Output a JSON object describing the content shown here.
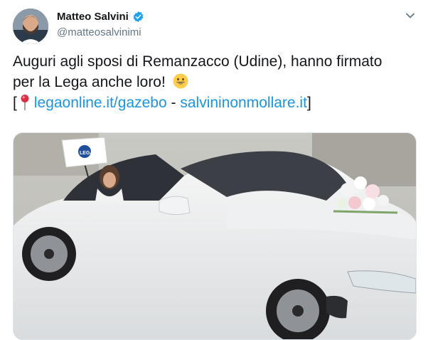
{
  "user": {
    "display_name": "Matteo Salvini",
    "handle": "@matteosalvinimi",
    "verified": true
  },
  "tweet": {
    "line1": "Auguri agli sposi di Remanzacco (Udine), hanno firmato",
    "line2": "per la Lega anche loro!",
    "emoji": "grinning-face-emoji",
    "bracket_open": "[",
    "link1": "legaonline.it/gazebo",
    "separator": " - ",
    "link2": "salvininonmollare.it",
    "bracket_close": "]"
  },
  "media": {
    "flag_text": "LEGA"
  },
  "colors": {
    "link": "#1b95e0",
    "verified": "#1da1f2",
    "secondary_text": "#657786"
  },
  "icons": [
    "verified-badge-icon",
    "chevron-down-icon",
    "pin-icon",
    "grinning-face-emoji"
  ]
}
